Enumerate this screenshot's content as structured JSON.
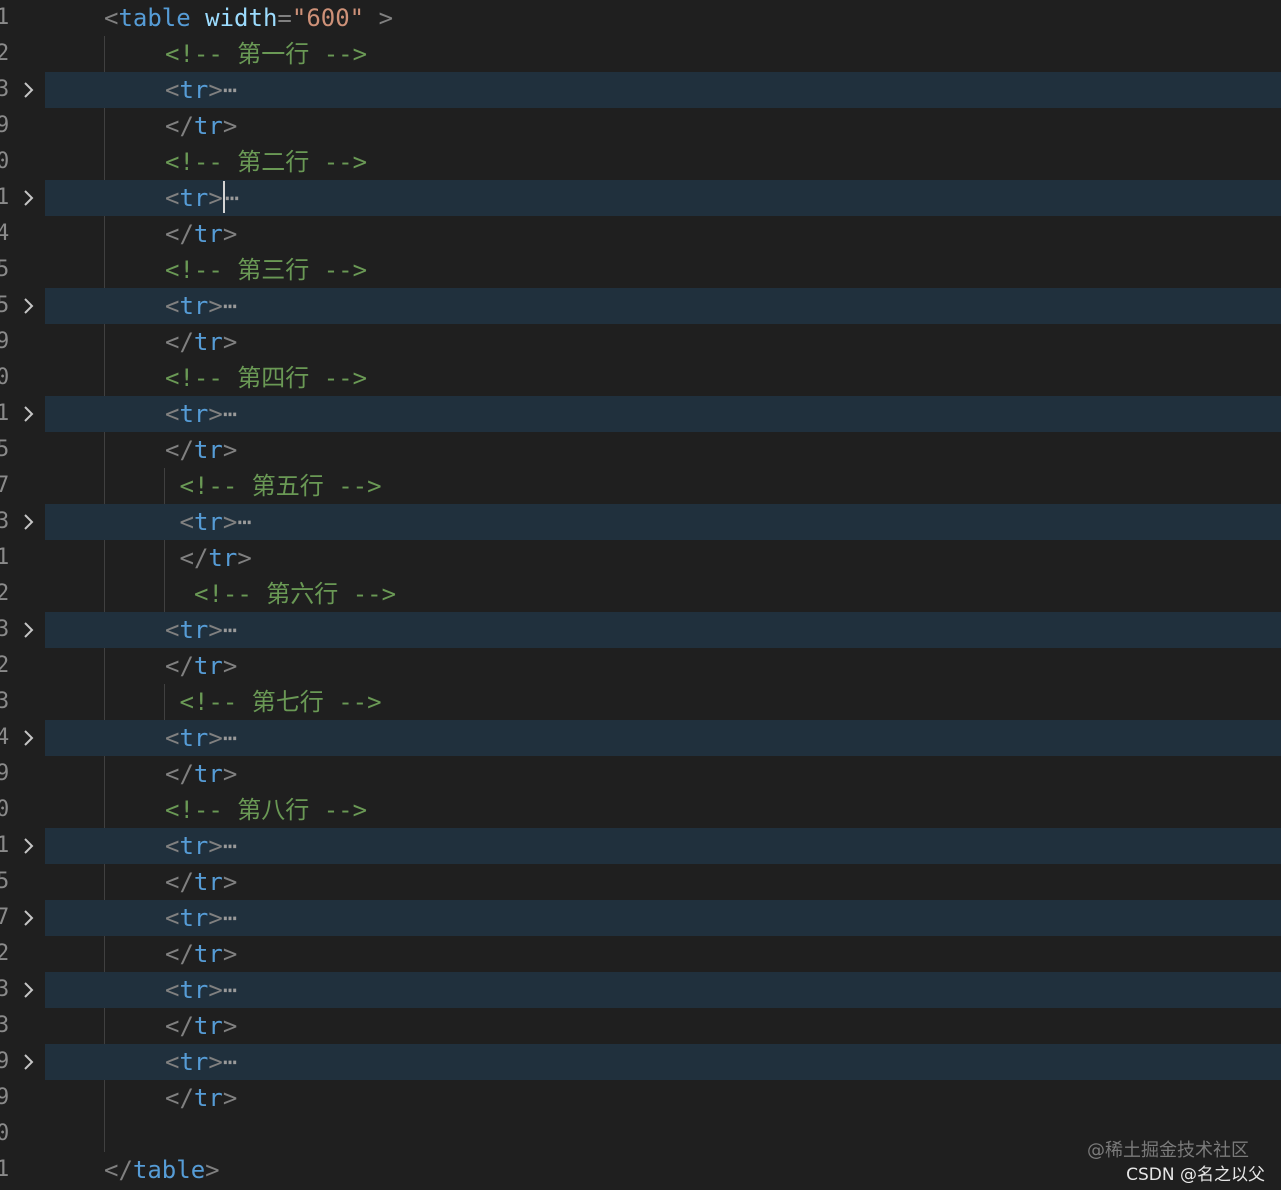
{
  "editor": {
    "lines": [
      {
        "num": "1",
        "fold": false,
        "type": "table-open",
        "tag": "table",
        "attr": "width",
        "value": "600"
      },
      {
        "num": "2",
        "fold": false,
        "type": "comment",
        "text": "<!-- 第一行 -->"
      },
      {
        "num": "3",
        "fold": true,
        "type": "tr-fold",
        "text": "tr"
      },
      {
        "num": "9",
        "fold": false,
        "type": "tr-close",
        "text": "tr"
      },
      {
        "num": "0",
        "fold": false,
        "type": "comment",
        "text": "<!-- 第二行 -->"
      },
      {
        "num": "1",
        "fold": true,
        "type": "tr-fold",
        "text": "tr",
        "cursor": true
      },
      {
        "num": "4",
        "fold": false,
        "type": "tr-close",
        "text": "tr"
      },
      {
        "num": "5",
        "fold": false,
        "type": "comment",
        "text": "<!-- 第三行 -->"
      },
      {
        "num": "5",
        "fold": true,
        "type": "tr-fold",
        "text": "tr"
      },
      {
        "num": "9",
        "fold": false,
        "type": "tr-close",
        "text": "tr"
      },
      {
        "num": "0",
        "fold": false,
        "type": "comment",
        "text": "<!-- 第四行 -->"
      },
      {
        "num": "1",
        "fold": true,
        "type": "tr-fold",
        "text": "tr"
      },
      {
        "num": "5",
        "fold": false,
        "type": "tr-close",
        "text": "tr"
      },
      {
        "num": "7",
        "fold": false,
        "type": "comment",
        "text": "<!-- 第五行 -->",
        "shift": 1
      },
      {
        "num": "3",
        "fold": true,
        "type": "tr-fold",
        "text": "tr",
        "shift": 1
      },
      {
        "num": "1",
        "fold": false,
        "type": "tr-close",
        "text": "tr",
        "shift": 1
      },
      {
        "num": "2",
        "fold": false,
        "type": "comment",
        "text": "<!-- 第六行 -->",
        "shift": 2
      },
      {
        "num": "3",
        "fold": true,
        "type": "tr-fold",
        "text": "tr"
      },
      {
        "num": "2",
        "fold": false,
        "type": "tr-close",
        "text": "tr"
      },
      {
        "num": "3",
        "fold": false,
        "type": "comment",
        "text": "<!-- 第七行 -->",
        "shift": 1
      },
      {
        "num": "4",
        "fold": true,
        "type": "tr-fold",
        "text": "tr"
      },
      {
        "num": "9",
        "fold": false,
        "type": "tr-close",
        "text": "tr"
      },
      {
        "num": "0",
        "fold": false,
        "type": "comment",
        "text": "<!-- 第八行 -->"
      },
      {
        "num": "1",
        "fold": true,
        "type": "tr-fold",
        "text": "tr"
      },
      {
        "num": "5",
        "fold": false,
        "type": "tr-close",
        "text": "tr"
      },
      {
        "num": "7",
        "fold": true,
        "type": "tr-fold",
        "text": "tr"
      },
      {
        "num": "2",
        "fold": false,
        "type": "tr-close",
        "text": "tr"
      },
      {
        "num": "3",
        "fold": true,
        "type": "tr-fold",
        "text": "tr"
      },
      {
        "num": "3",
        "fold": false,
        "type": "tr-close",
        "text": "tr"
      },
      {
        "num": "9",
        "fold": true,
        "type": "tr-fold",
        "text": "tr"
      },
      {
        "num": "9",
        "fold": false,
        "type": "tr-close",
        "text": "tr"
      },
      {
        "num": "0",
        "fold": false,
        "type": "empty"
      },
      {
        "num": "1",
        "fold": false,
        "type": "table-close",
        "tag": "table"
      }
    ],
    "ellipsis": "⋯"
  },
  "watermark": {
    "line1": "@稀土掘金技术社区",
    "line2": "CSDN @名之以父"
  },
  "colors": {
    "background": "#1f1f1f",
    "folded_line": "#20303d",
    "tag": "#569cd6",
    "attribute": "#9cdcfe",
    "string": "#ce9178",
    "comment": "#6a9955",
    "bracket": "#808080"
  }
}
